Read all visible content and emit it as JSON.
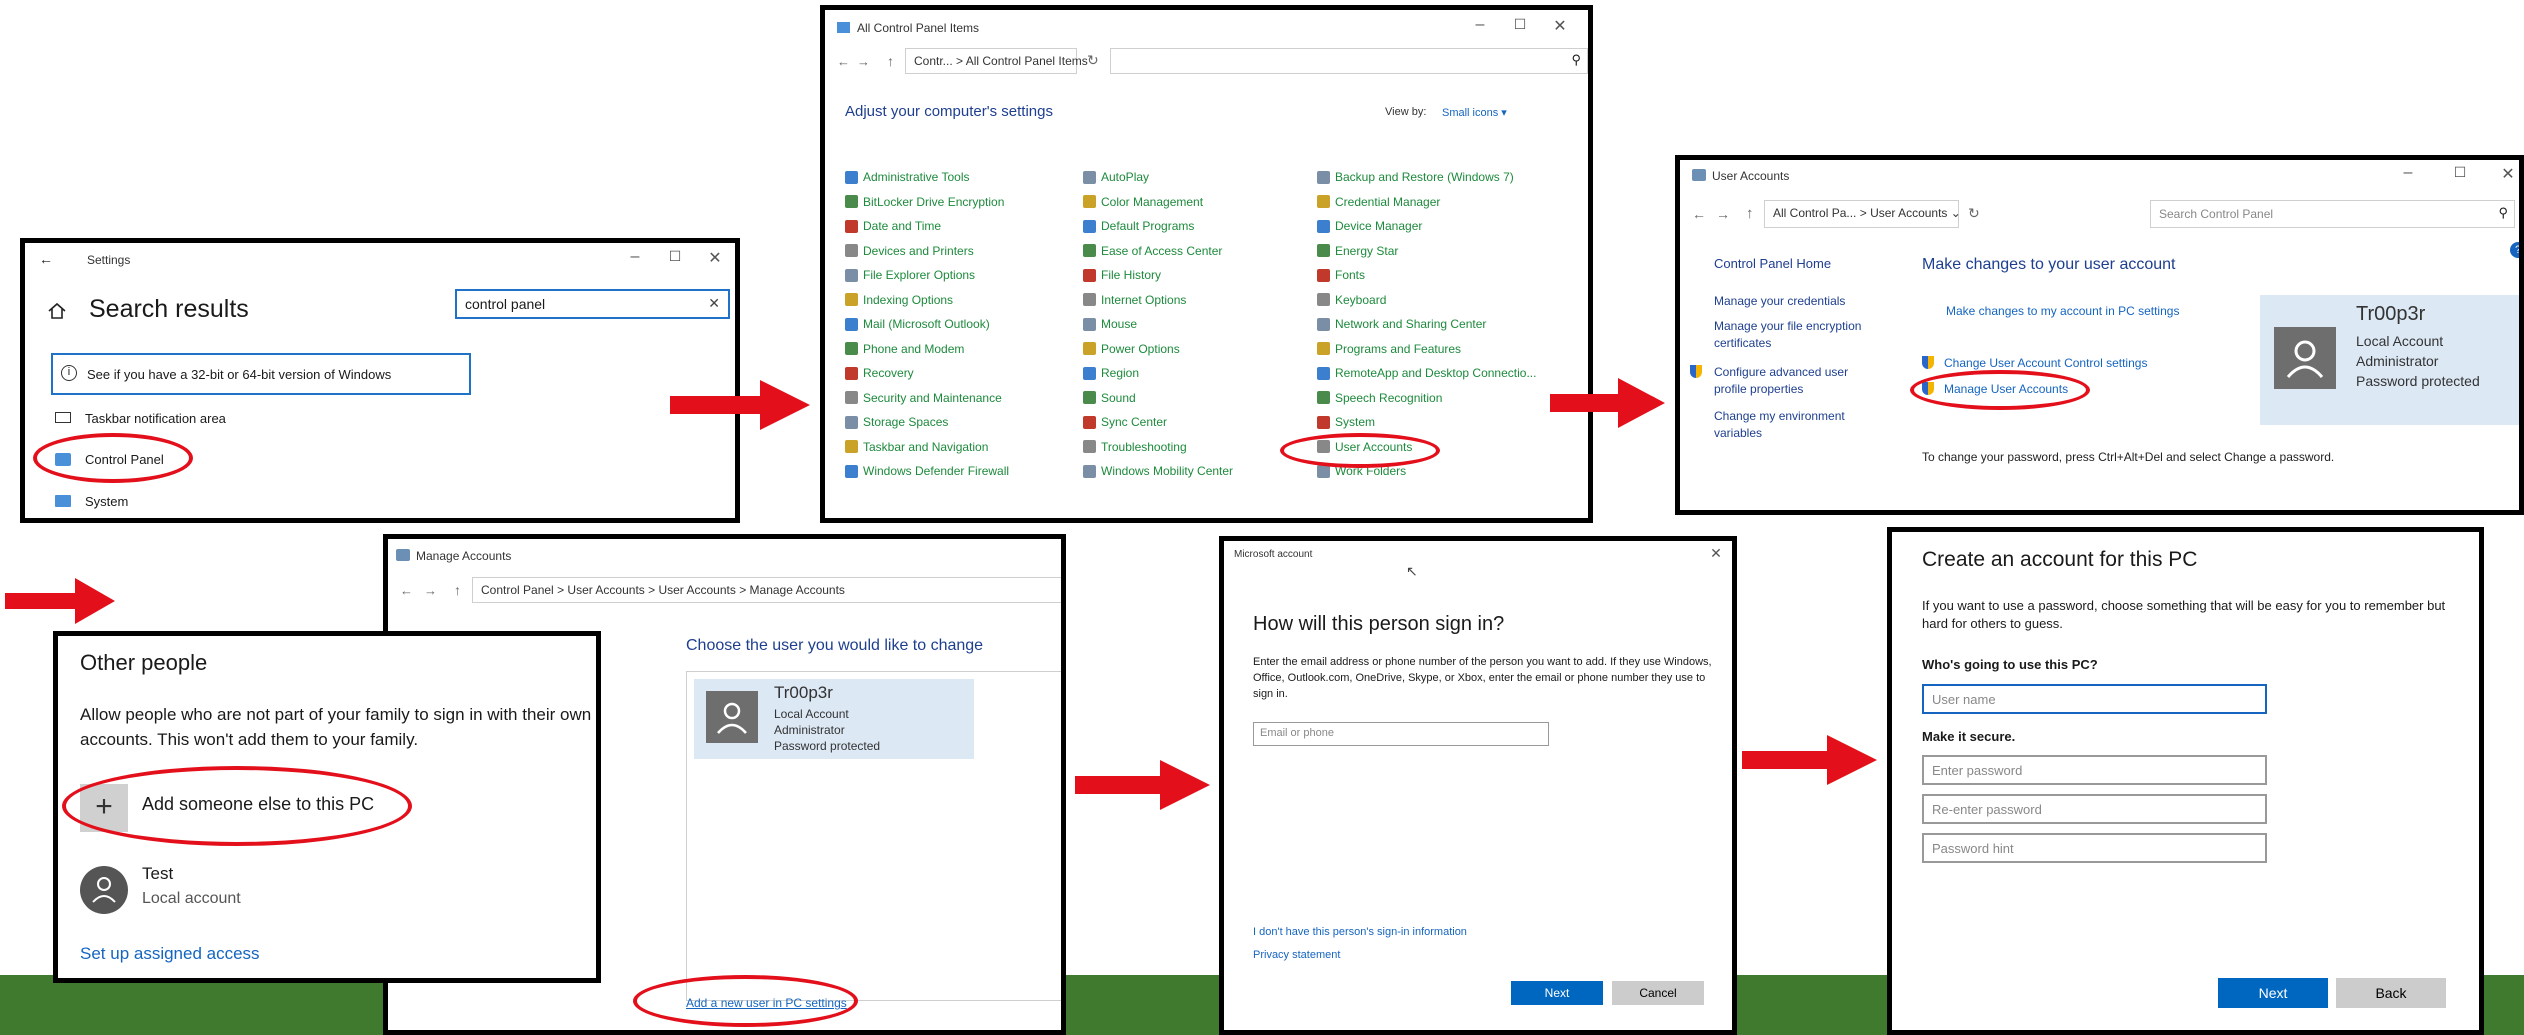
{
  "colors": {
    "accent_red": "#e3101b",
    "link_blue": "#1565c0",
    "cp_green": "#1d8a3c",
    "button_blue": "#0067c0",
    "grass": "#3f7a2e"
  },
  "settings": {
    "title": "Settings",
    "heading": "Search results",
    "search_value": "control panel",
    "results": [
      "See if you have a 32-bit or 64-bit version of Windows",
      "Taskbar notification area",
      "Control Panel",
      "System"
    ]
  },
  "control_panel": {
    "title": "All Control Panel Items",
    "breadcrumb": [
      "Contr...",
      "All Control Panel Items"
    ],
    "heading": "Adjust your computer's settings",
    "view_by_label": "View by:",
    "view_by_value": "Small icons",
    "col1": [
      "Administrative Tools",
      "BitLocker Drive Encryption",
      "Date and Time",
      "Devices and Printers",
      "File Explorer Options",
      "Indexing Options",
      "Mail (Microsoft Outlook)",
      "Phone and Modem",
      "Recovery",
      "Security and Maintenance",
      "Storage Spaces",
      "Taskbar and Navigation",
      "Windows Defender Firewall"
    ],
    "col2": [
      "AutoPlay",
      "Color Management",
      "Default Programs",
      "Ease of Access Center",
      "File History",
      "Internet Options",
      "Mouse",
      "Power Options",
      "Region",
      "Sound",
      "Sync Center",
      "Troubleshooting",
      "Windows Mobility Center"
    ],
    "col3": [
      "Backup and Restore (Windows 7)",
      "Credential Manager",
      "Device Manager",
      "Energy Star",
      "Fonts",
      "Keyboard",
      "Network and Sharing Center",
      "Programs and Features",
      "RemoteApp and Desktop Connectio...",
      "Speech Recognition",
      "System",
      "User Accounts",
      "Work Folders"
    ]
  },
  "user_accounts": {
    "title": "User Accounts",
    "breadcrumb": [
      "All Control Pa...",
      "User Accounts"
    ],
    "search_placeholder": "Search Control Panel",
    "side_links": [
      "Control Panel Home",
      "Manage your credentials",
      "Manage your file encryption certificates",
      "Configure advanced user profile properties",
      "Change my environment variables"
    ],
    "heading": "Make changes to your user account",
    "link_pc_settings": "Make changes to my account in PC settings",
    "link_uac": "Change User Account Control settings",
    "link_manage": "Manage User Accounts",
    "note": "To change your password, press Ctrl+Alt+Del and select Change a password.",
    "account": {
      "name": "Tr00p3r",
      "lines": [
        "Local Account",
        "Administrator",
        "Password protected"
      ]
    }
  },
  "other_people": {
    "heading": "Other people",
    "description": "Allow people who are not part of your family to sign in with their own accounts. This won't add them to your family.",
    "add_label": "Add someone else to this PC",
    "user_name": "Test",
    "user_type": "Local account",
    "assigned_access": "Set up assigned access"
  },
  "manage_accounts": {
    "title": "Manage Accounts",
    "breadcrumb": [
      "Control Panel",
      "User Accounts",
      "User Accounts",
      "Manage Accounts"
    ],
    "heading": "Choose the user you would like to change",
    "account": {
      "name": "Tr00p3r",
      "lines": [
        "Local Account",
        "Administrator",
        "Password protected"
      ]
    },
    "add_link": "Add a new user in PC settings"
  },
  "ms_account": {
    "title": "Microsoft account",
    "heading": "How will this person sign in?",
    "description": "Enter the email address or phone number of the person you want to add. If they use Windows, Office, Outlook.com, OneDrive, Skype, or Xbox, enter the email or phone number they use to sign in.",
    "input_placeholder": "Email or phone",
    "no_info_link": "I don't have this person's sign-in information",
    "privacy_link": "Privacy statement",
    "next": "Next",
    "cancel": "Cancel"
  },
  "create_account": {
    "heading": "Create an account for this PC",
    "description": "If you want to use a password, choose something that will be easy for you to remember but hard for others to guess.",
    "who_label": "Who's going to use this PC?",
    "username_placeholder": "User name",
    "secure_label": "Make it secure.",
    "password_placeholder": "Enter password",
    "reenter_placeholder": "Re-enter password",
    "hint_placeholder": "Password hint",
    "next": "Next",
    "back": "Back"
  }
}
